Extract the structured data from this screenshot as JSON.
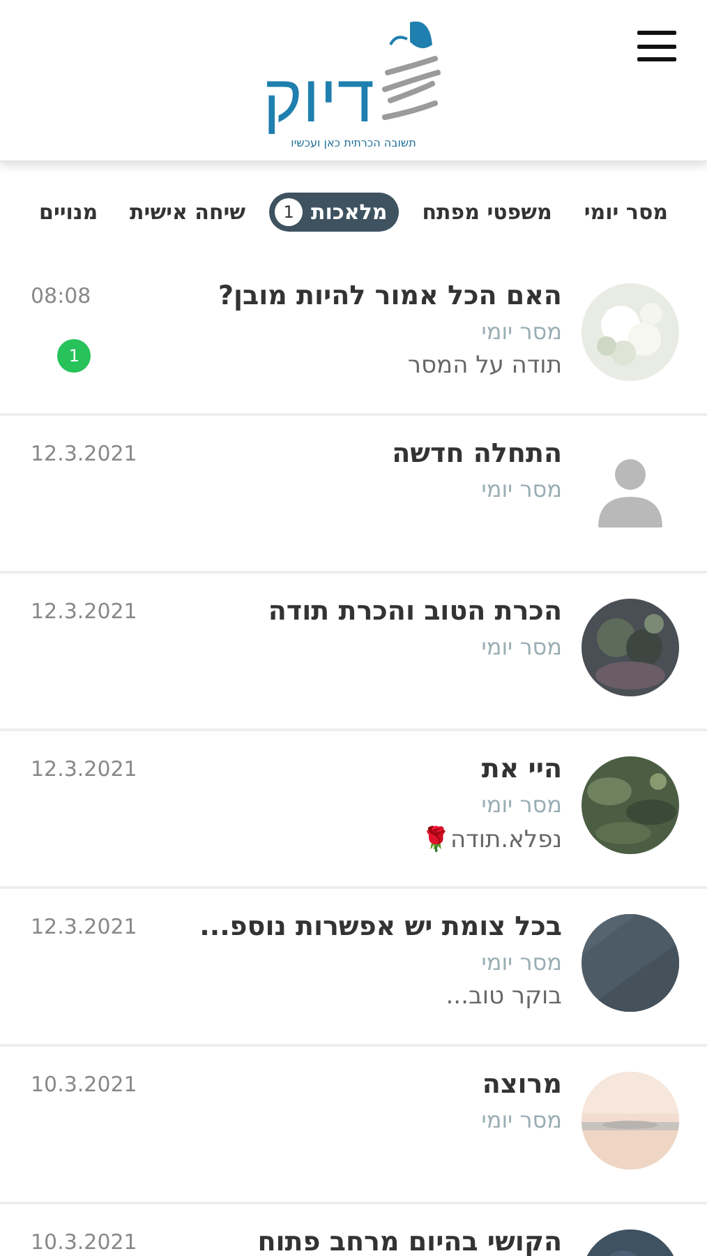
{
  "header": {
    "logo_text": "דיוק",
    "tagline": "תשובה הכרתית כאן ועכשיו"
  },
  "tabs": [
    {
      "label": "מסר יומי",
      "selected": false
    },
    {
      "label": "משפטי מפתח",
      "selected": false
    },
    {
      "label": "מלאכות",
      "selected": true,
      "count": "1"
    },
    {
      "label": "שיחה אישית",
      "selected": false
    },
    {
      "label": "מנויים",
      "selected": false
    }
  ],
  "conversations": [
    {
      "title": "האם הכל אמור להיות מובן?",
      "channel": "מסר יומי",
      "preview": "תודה על המסר",
      "time": "08:08",
      "unread": "1"
    },
    {
      "avatar": {
        "kind": "person"
      },
      "title": "התחלה חדשה",
      "channel": "מסר יומי",
      "time": "12.3.2021"
    },
    {
      "title": "הכרת הטוב והכרת תודה",
      "channel": "מסר יומי",
      "time": "12.3.2021"
    },
    {
      "title": "היי את",
      "channel": "מסר יומי",
      "preview": "נפלא.תודה🌹",
      "time": "12.3.2021"
    },
    {
      "title": "בכל צומת יש אפשרות נוספ...",
      "channel": "מסר יומי",
      "preview": "בוקר טוב...",
      "time": "12.3.2021"
    },
    {
      "title": "מרוצה",
      "channel": "מסר יומי",
      "time": "10.3.2021"
    },
    {
      "title": "הקושי בהיום מרחב פתוח",
      "time": "10.3.2021"
    }
  ]
}
